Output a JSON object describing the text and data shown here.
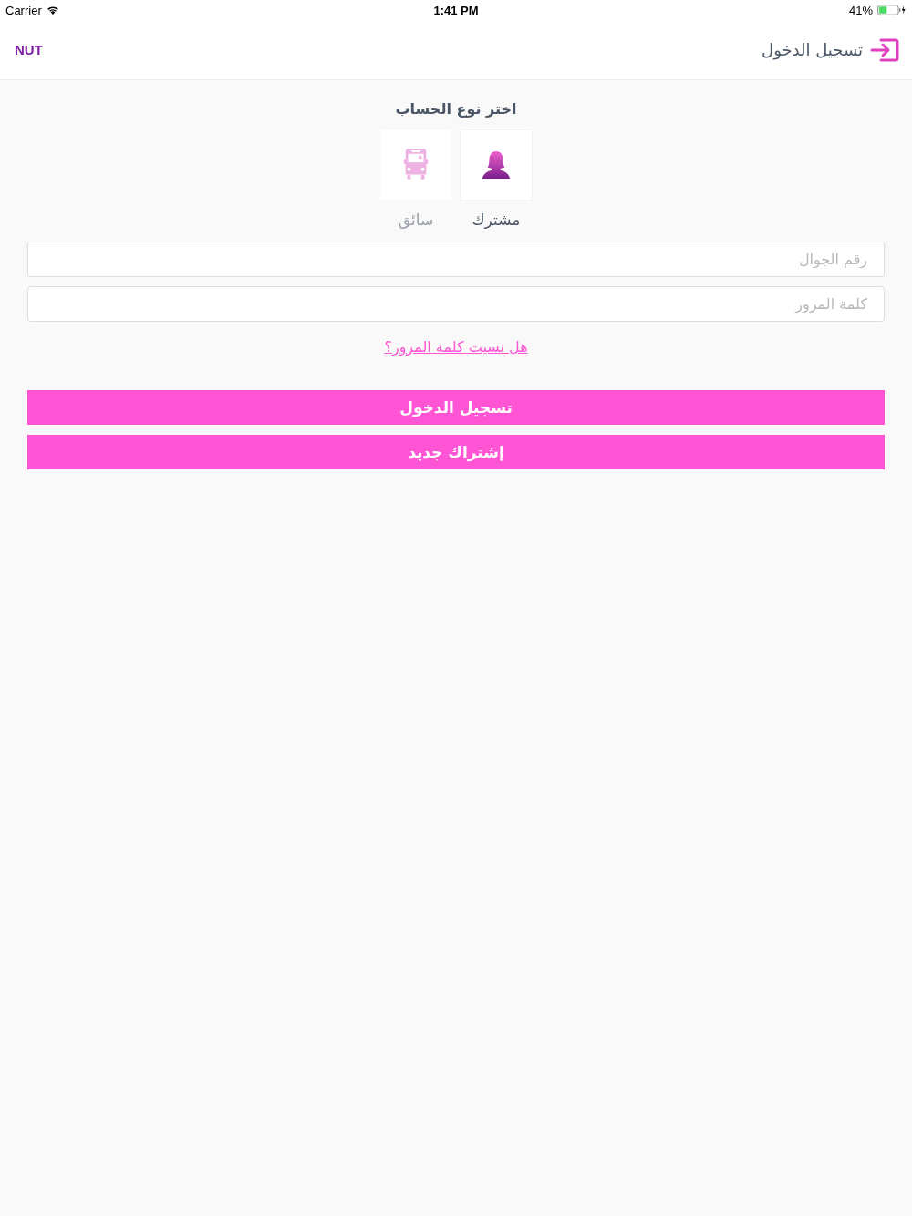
{
  "status_bar": {
    "carrier": "Carrier",
    "time": "1:41 PM",
    "battery": "41%"
  },
  "nav_bar": {
    "brand": "NUT",
    "title": "تسجيل الدخول"
  },
  "account_type": {
    "heading": "اختر نوع الحساب",
    "options": [
      {
        "kind": "person",
        "label": "مشترك",
        "selected": true
      },
      {
        "kind": "bus",
        "label": "سائق",
        "selected": false
      }
    ]
  },
  "fields": [
    {
      "placeholder": "رقم الجوال"
    },
    {
      "placeholder": "كلمة المرور"
    }
  ],
  "forgot_link": "هل نسيت كلمة المرور؟",
  "buttons": [
    "تسجيل الدخول",
    "إشتراك جديد"
  ]
}
